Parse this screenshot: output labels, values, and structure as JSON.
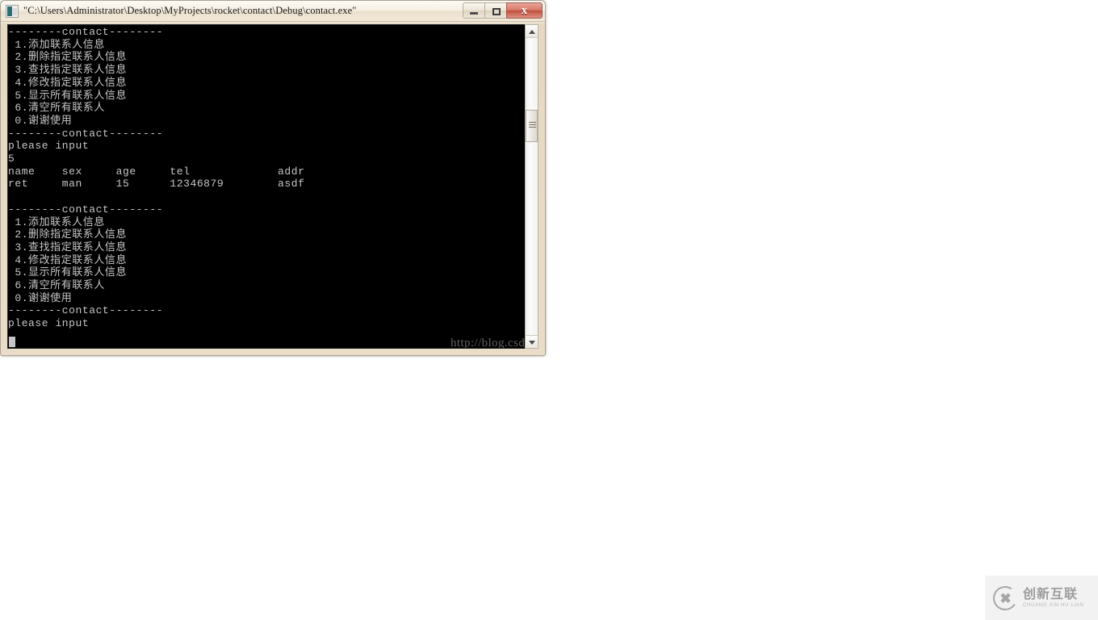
{
  "desktop": {
    "background_color": "#ffffff"
  },
  "window": {
    "title": "\"C:\\Users\\Administrator\\Desktop\\MyProjects\\rocket\\contact\\Debug\\contact.exe\"",
    "icon": "console-app-icon",
    "controls": {
      "minimize_label": "–",
      "maximize_label": "□",
      "close_label": "x"
    },
    "frame_color": "#e9ddc9",
    "client_background": "#000000",
    "text_color": "#c5c5c5"
  },
  "console": {
    "separator": "--------contact--------",
    "menu": [
      "1.添加联系人信息",
      "2.删除指定联系人信息",
      "3.查找指定联系人信息",
      "4.修改指定联系人信息",
      "5.显示所有联系人信息",
      "6.清空所有联系人",
      "0.谢谢使用"
    ],
    "prompt": "please input",
    "user_choice": "5",
    "table": {
      "headers": [
        "name",
        "sex",
        "age",
        "tel",
        "addr"
      ],
      "rows": [
        [
          "ret",
          "man",
          "15",
          "12346879",
          "asdf"
        ]
      ]
    },
    "full_text": "--------contact--------\n 1.添加联系人信息\n 2.删除指定联系人信息\n 3.查找指定联系人信息\n 4.修改指定联系人信息\n 5.显示所有联系人信息\n 6.清空所有联系人\n 0.谢谢使用\n--------contact--------\nplease input\n5\nname    sex     age     tel             addr\nret     man     15      12346879        asdf\n\n--------contact--------\n 1.添加联系人信息\n 2.删除指定联系人信息\n 3.查找指定联系人信息\n 4.修改指定联系人信息\n 5.显示所有联系人信息\n 6.清空所有联系人\n 0.谢谢使用\n--------contact--------\nplease input"
  },
  "scrollbar": {
    "up_arrow": "▲",
    "down_arrow": "▼"
  },
  "watermark": {
    "url": "http://blog.csdn.net/ret_skd"
  },
  "brand": {
    "mark": "cx-circle-logo",
    "name_cn": "创新互联",
    "name_en": "CHUANG XIN HU LIAN"
  }
}
